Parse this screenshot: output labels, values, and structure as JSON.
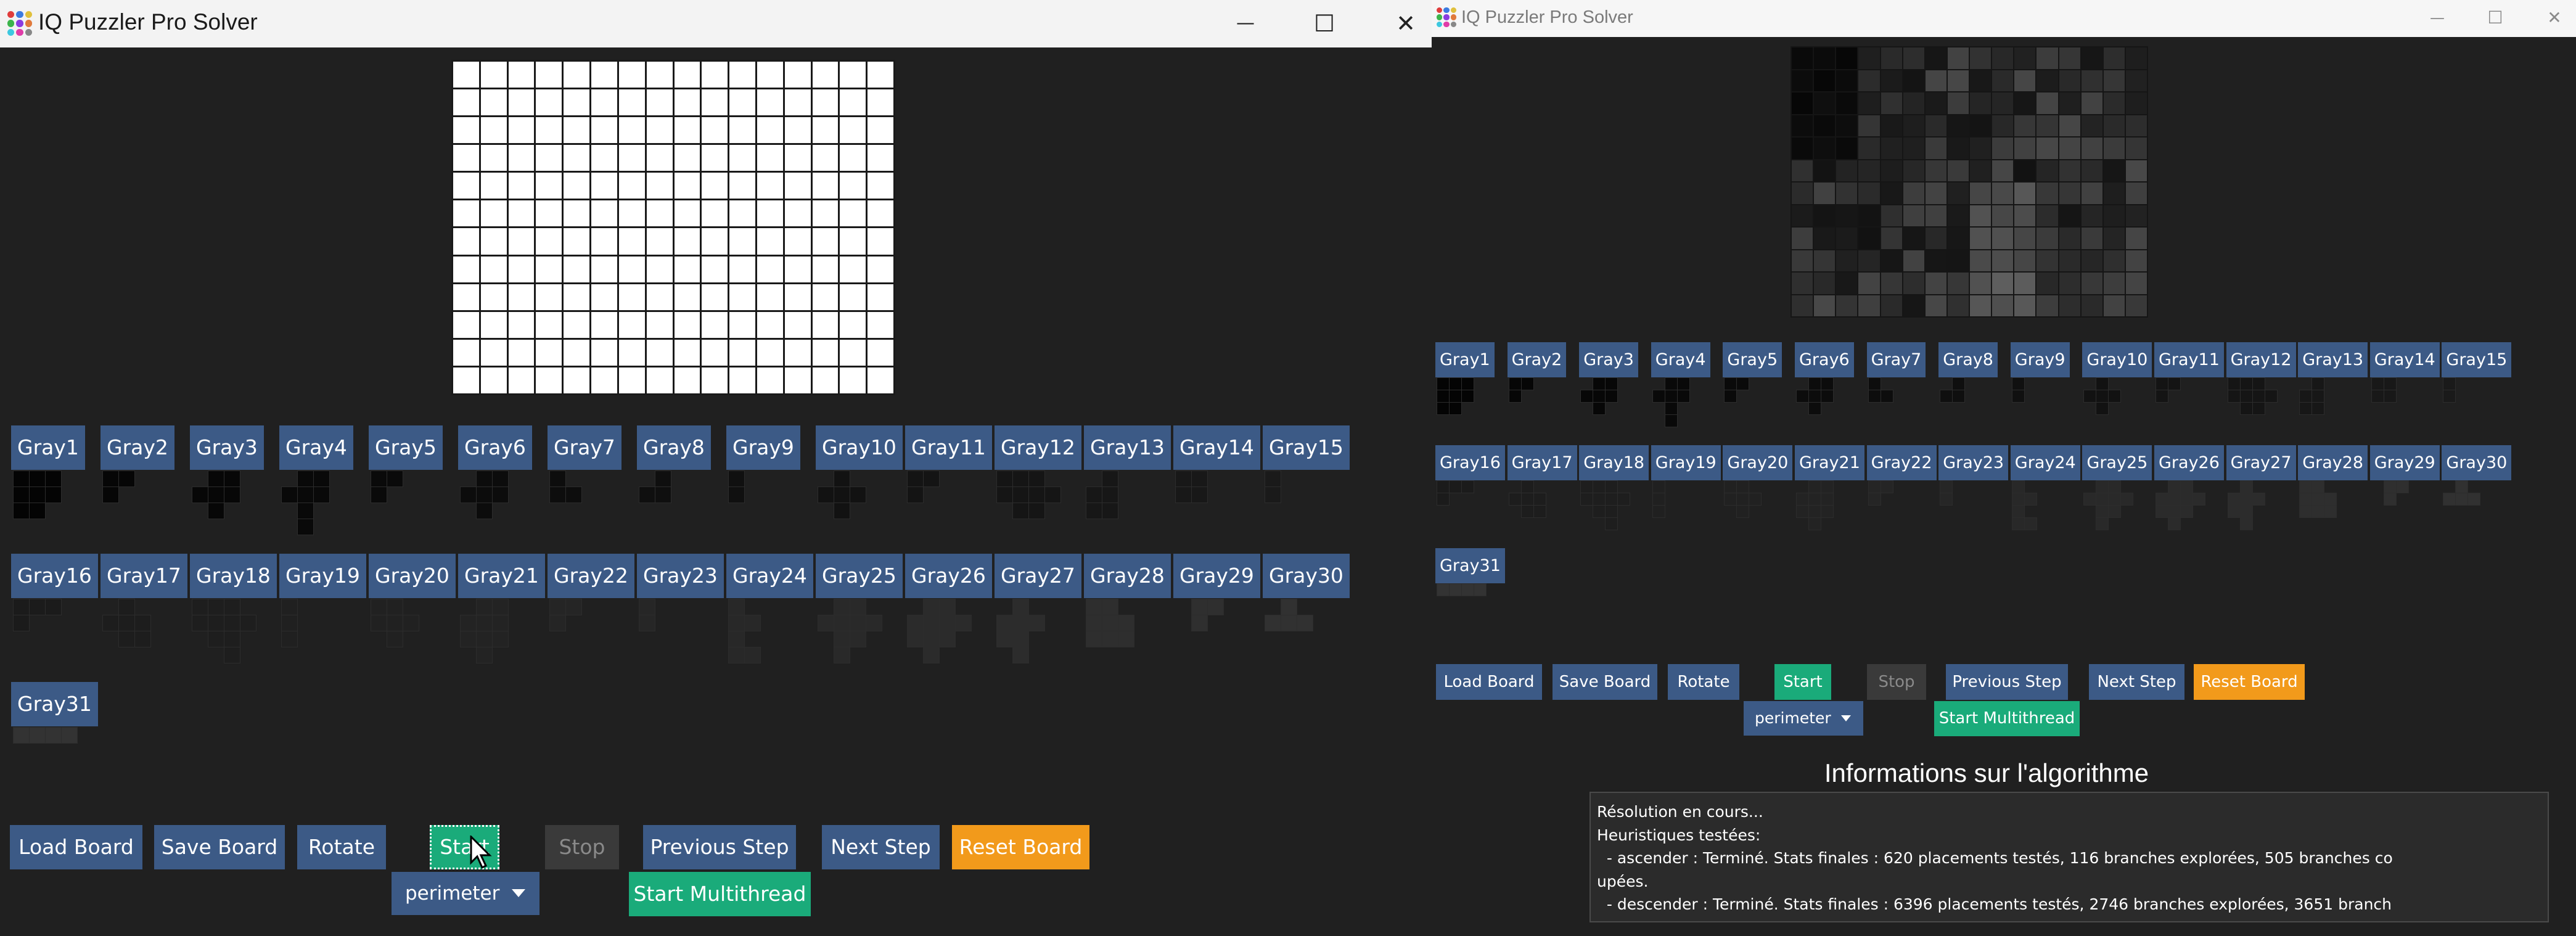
{
  "left_window": {
    "title": "IQ Puzzler Pro Solver",
    "controls": {
      "minimize": "—",
      "maximize": "☐",
      "close": "✕"
    },
    "pieces": [
      "Gray1",
      "Gray2",
      "Gray3",
      "Gray4",
      "Gray5",
      "Gray6",
      "Gray7",
      "Gray8",
      "Gray9",
      "Gray10",
      "Gray11",
      "Gray12",
      "Gray13",
      "Gray14",
      "Gray15",
      "Gray16",
      "Gray17",
      "Gray18",
      "Gray19",
      "Gray20",
      "Gray21",
      "Gray22",
      "Gray23",
      "Gray24",
      "Gray25",
      "Gray26",
      "Gray27",
      "Gray28",
      "Gray29",
      "Gray30",
      "Gray31"
    ],
    "buttons": {
      "load_board": "Load Board",
      "save_board": "Save Board",
      "rotate": "Rotate",
      "start": "Start",
      "stop": "Stop",
      "previous_step": "Previous Step",
      "next_step": "Next Step",
      "reset_board": "Reset Board",
      "start_multithread": "Start Multithread"
    },
    "heuristic_select": "perimeter"
  },
  "right_window": {
    "title": "IQ Puzzler Pro Solver",
    "controls": {
      "minimize": "—",
      "maximize": "☐",
      "close": "✕"
    },
    "pieces": [
      "Gray1",
      "Gray2",
      "Gray3",
      "Gray4",
      "Gray5",
      "Gray6",
      "Gray7",
      "Gray8",
      "Gray9",
      "Gray10",
      "Gray11",
      "Gray12",
      "Gray13",
      "Gray14",
      "Gray15",
      "Gray16",
      "Gray17",
      "Gray18",
      "Gray19",
      "Gray20",
      "Gray21",
      "Gray22",
      "Gray23",
      "Gray24",
      "Gray25",
      "Gray26",
      "Gray27",
      "Gray28",
      "Gray29",
      "Gray30",
      "Gray31"
    ],
    "buttons": {
      "load_board": "Load Board",
      "save_board": "Save Board",
      "rotate": "Rotate",
      "start": "Start",
      "stop": "Stop",
      "previous_step": "Previous Step",
      "next_step": "Next Step",
      "reset_board": "Reset Board",
      "start_multithread": "Start Multithread"
    },
    "heuristic_select": "perimeter",
    "info_title": "Informations sur l'algorithme",
    "info_lines": [
      "Résolution en cours...",
      "Heuristiques testées:",
      "  - ascender : Terminé. Stats finales : 620 placements testés, 116 branches explorées, 505 branches co",
      "upées.",
      "  - descender : Terminé. Stats finales : 6396 placements testés, 2746 branches explorées, 3651 branch"
    ]
  },
  "colors": {
    "background": "#202020",
    "piece_button": "#3c5a86",
    "start_green": "#1aab7a",
    "reset_orange": "#f29a1b",
    "stop_gray": "#3a3a3a",
    "board_empty": "#ffffff"
  },
  "icons": [
    "app-icon",
    "minimize-icon",
    "maximize-icon",
    "close-icon",
    "chevron-down-icon",
    "mouse-cursor-icon"
  ]
}
